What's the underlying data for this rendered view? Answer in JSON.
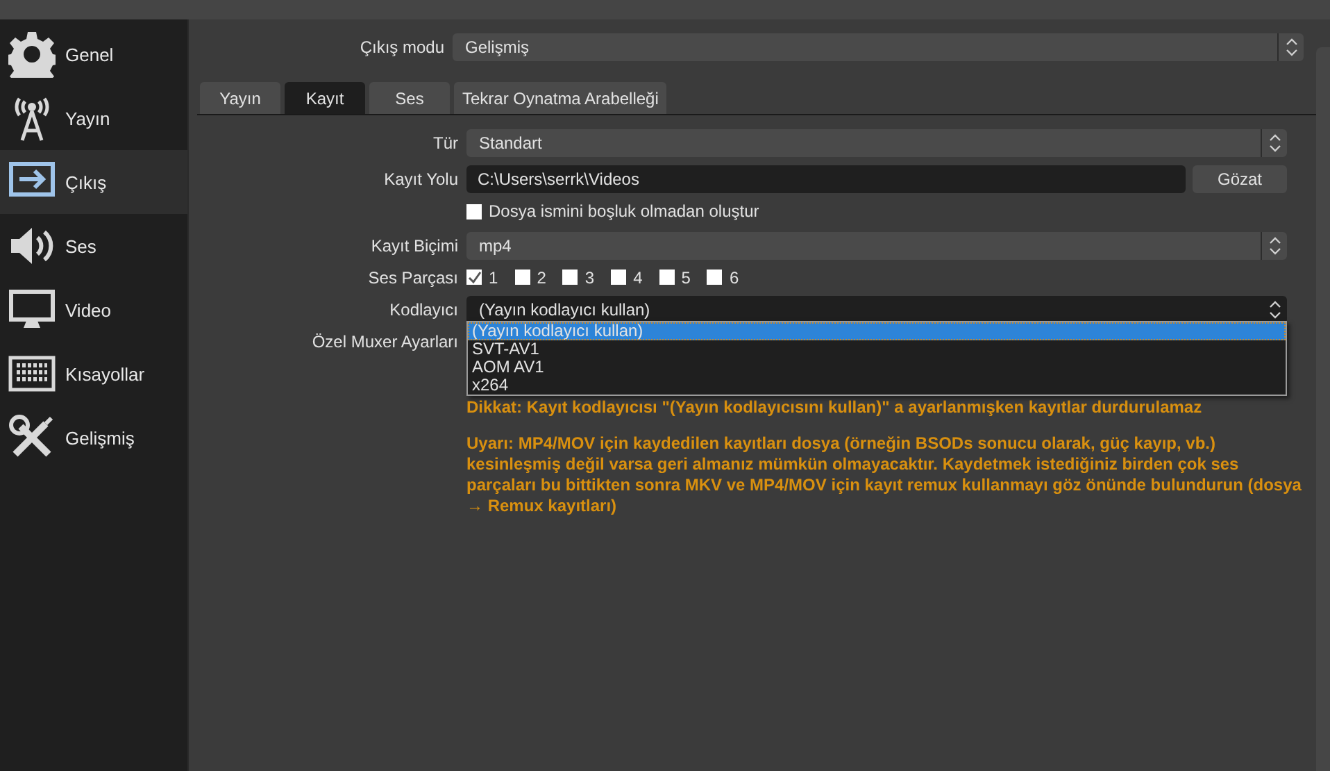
{
  "sidebar": {
    "items": [
      {
        "label": "Genel",
        "selected": false
      },
      {
        "label": "Yayın",
        "selected": false
      },
      {
        "label": "Çıkış",
        "selected": true
      },
      {
        "label": "Ses",
        "selected": false
      },
      {
        "label": "Video",
        "selected": false
      },
      {
        "label": "Kısayollar",
        "selected": false
      },
      {
        "label": "Gelişmiş",
        "selected": false
      }
    ]
  },
  "output_mode": {
    "label": "Çıkış modu",
    "value": "Gelişmiş"
  },
  "tabs": [
    {
      "label": "Yayın",
      "selected": false
    },
    {
      "label": "Kayıt",
      "selected": true
    },
    {
      "label": "Ses",
      "selected": false
    },
    {
      "label": "Tekrar Oynatma Arabelleği",
      "selected": false
    }
  ],
  "form": [
    {
      "kind": "combo",
      "label": "Tür",
      "value": "Standart"
    },
    {
      "kind": "path",
      "label": "Kayıt Yolu",
      "value": "C:\\Users\\serrk\\Videos",
      "button": "Gözat"
    },
    {
      "kind": "checkbox",
      "text": "Dosya ismini boşluk olmadan oluştur",
      "checked": false
    },
    {
      "kind": "combo",
      "label": "Kayıt Biçimi",
      "value": "mp4"
    },
    {
      "kind": "checks",
      "label": "Ses Parçası",
      "tracks": [
        {
          "text": "1",
          "checked": true
        },
        {
          "text": "2",
          "checked": false
        },
        {
          "text": "3",
          "checked": false
        },
        {
          "text": "4",
          "checked": false
        },
        {
          "text": "5",
          "checked": false
        },
        {
          "text": "6",
          "checked": false
        }
      ]
    },
    {
      "kind": "open-combo",
      "label": "Kodlayıcı",
      "value": "(Yayın kodlayıcı kullan)",
      "options": [
        {
          "text": "(Yayın kodlayıcı kullan)",
          "selected": true
        },
        {
          "text": "SVT-AV1",
          "selected": false
        },
        {
          "text": "AOM AV1",
          "selected": false
        },
        {
          "text": "x264",
          "selected": false
        }
      ]
    },
    {
      "kind": "label",
      "label": "Özel Muxer Ayarları"
    }
  ],
  "notes": [
    "Dikkat: Kayıt kodlayıcısı \"(Yayın kodlayıcısını kullan)\" a ayarlanmışken kayıtlar durdurulamaz",
    "Uyarı: MP4/MOV için kaydedilen kayıtları dosya (örneğin BSODs sonucu olarak, güç kayıp, vb.) kesinleşmiş değil varsa geri almanız mümkün olmayacaktır. Kaydetmek istediğiniz birden çok ses parçaları bu bittikten sonra MKV ve MP4/MOV için kayıt remux kullanmayı göz önünde bulundurun (dosya → Remux kayıtları)"
  ]
}
